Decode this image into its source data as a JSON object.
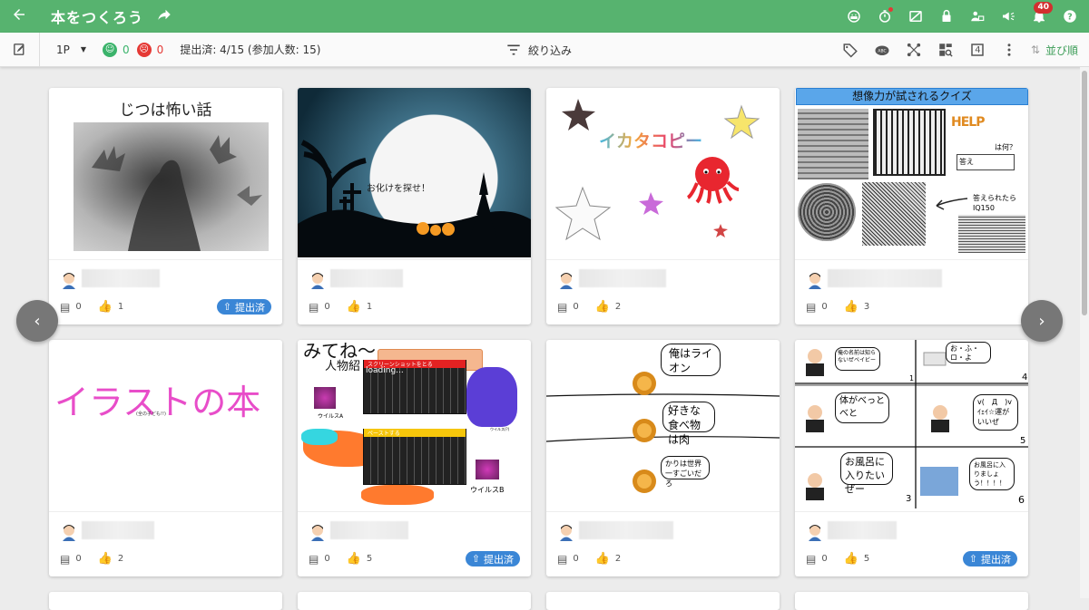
{
  "appbar": {
    "title": "本をつくろう",
    "notification_count": "40",
    "icons": [
      "back-arrow-icon",
      "share-arrow-icon",
      "face-mask-icon",
      "timer-icon",
      "no-image-icon",
      "lock-icon",
      "people-off-icon",
      "megaphone-off-icon",
      "bell-icon",
      "help-icon"
    ]
  },
  "toolbar": {
    "page": "1P",
    "positive_count": "0",
    "negative_count": "0",
    "submitted": "提出済: 4/15 (参加人数: 15)",
    "filter_label": "絞り込み",
    "page_number_icon": "4",
    "sort_label": "並び順"
  },
  "cards": [
    {
      "id": "c1",
      "comments": "0",
      "likes": "1",
      "submitted": true,
      "title": "じつは怖い話"
    },
    {
      "id": "c2",
      "comments": "0",
      "likes": "1",
      "submitted": false,
      "title": "",
      "caption": "お化けを探せ！"
    },
    {
      "id": "c3",
      "comments": "0",
      "likes": "2",
      "submitted": false,
      "title": "イカタコピー"
    },
    {
      "id": "c4",
      "comments": "0",
      "likes": "3",
      "submitted": false,
      "title": "想像力が試されるクイズ",
      "answer": "答え",
      "question": "は何？",
      "hint": "答えられたら IQ150"
    },
    {
      "id": "c5",
      "comments": "0",
      "likes": "2",
      "submitted": false,
      "title": "イラストの本",
      "sub": "(全の子ども!!)"
    },
    {
      "id": "c6",
      "comments": "0",
      "likes": "5",
      "submitted": true,
      "title": "みてね～",
      "sub": "人物紹",
      "loading": "loading...",
      "screenshot": "スクリーンショットをとる",
      "paste": "ペーストする",
      "virusA": "ウイルスA",
      "virusB": "ウイルスB",
      "small": "ウイルス(?)"
    },
    {
      "id": "c7",
      "comments": "0",
      "likes": "2",
      "submitted": false,
      "b1": "俺はライオン",
      "b2": "好きな食べ物は肉",
      "b3": "かりは世界一すごいだろ"
    },
    {
      "id": "c8",
      "comments": "0",
      "likes": "5",
      "submitted": true,
      "p1": "俺の名前は知らないぜベイビー",
      "p2": "お・ふ・ロ・よ",
      "p3": "体がべっとべと",
      "p4": "v(　Д　)v ｲｪｲ☆運がいいぜ",
      "p5": "お風呂に入りたいぜー",
      "p6": "お風呂に入りましょう！！！！",
      "n1": "1",
      "n2": "4",
      "n3": "5",
      "n4": "3",
      "n5": "6"
    }
  ],
  "submitted_label": "提出済"
}
